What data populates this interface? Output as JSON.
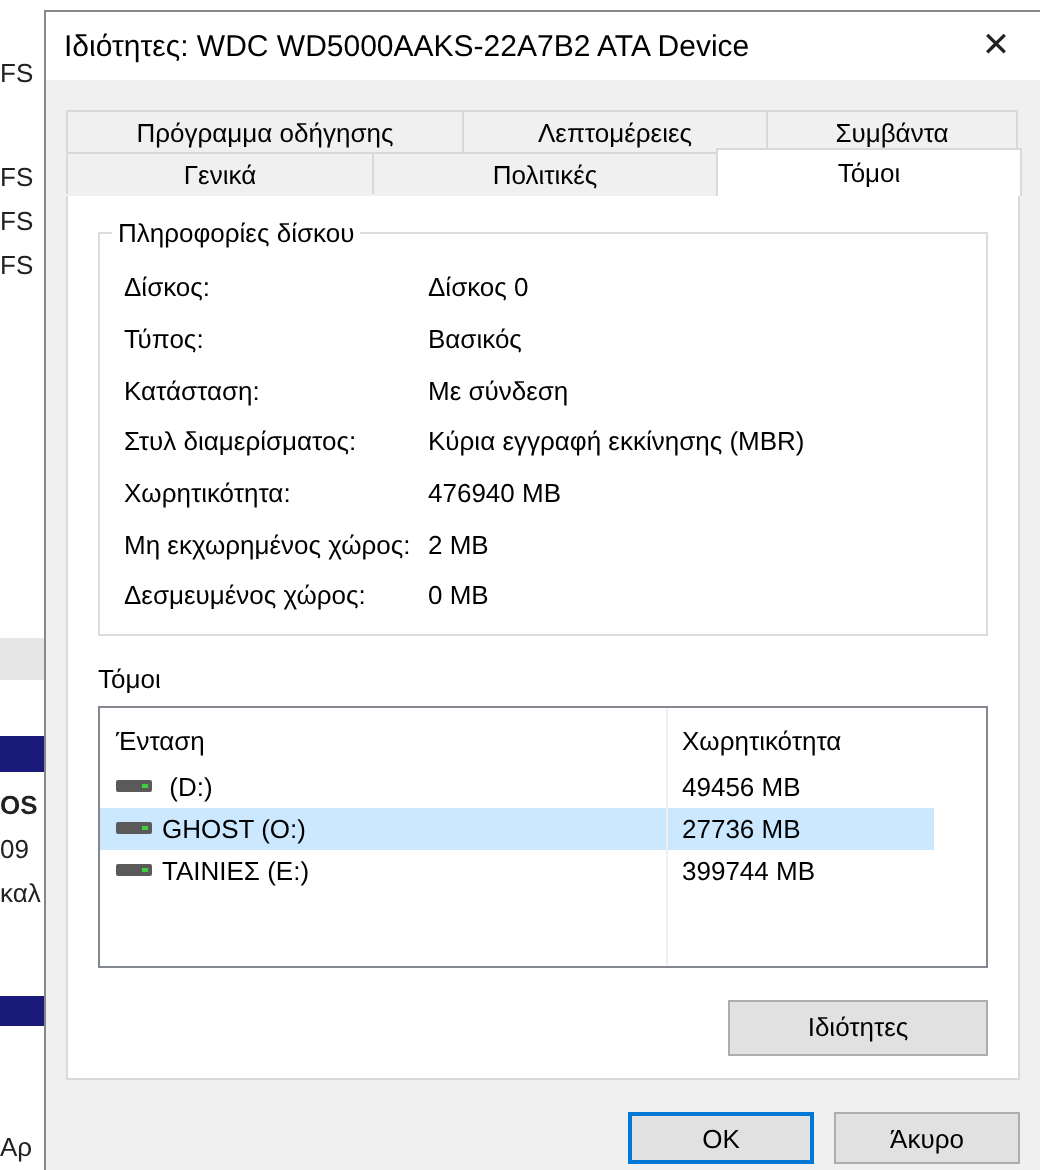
{
  "background_window": {
    "texts": [
      "FS",
      "FS",
      "FS",
      "FS"
    ],
    "lower_texts": [
      "OS",
      "09",
      "καλ"
    ],
    "bottom_text": "Αρ"
  },
  "window": {
    "title": "Ιδιότητες: WDC WD5000AAKS-22A7B2 ATA Device",
    "close": "✕"
  },
  "tab_rows": [
    [
      {
        "label": "Πρόγραμμα οδήγησης",
        "selected": false
      },
      {
        "label": "Λεπτομέρειες",
        "selected": false
      },
      {
        "label": "Συμβάντα",
        "selected": false
      }
    ],
    [
      {
        "label": "Γενικά",
        "selected": false
      },
      {
        "label": "Πολιτικές",
        "selected": false
      },
      {
        "label": "Τόμοι",
        "selected": true
      }
    ]
  ],
  "disk_info": {
    "title": "Πληροφορίες δίσκου",
    "rows": [
      {
        "label": "Δίσκος:",
        "value": "Δίσκος 0"
      },
      {
        "label": "Τύπος:",
        "value": "Βασικός"
      },
      {
        "label": "Κατάσταση:",
        "value": "Με σύνδεση"
      },
      {
        "label": "Στυλ διαμερίσματος:",
        "value": "Κύρια εγγραφή εκκίνησης (MBR)"
      },
      {
        "label": "Χωρητικότητα:",
        "value": "476940 MB"
      },
      {
        "label": "Μη εκχωρημένος χώρος:",
        "value": "2 MB"
      },
      {
        "label": "Δεσμευμένος χώρος:",
        "value": "0 MB"
      }
    ]
  },
  "volumes": {
    "title": "Τόμοι",
    "columns": [
      "Ένταση",
      "Χωρητικότητα"
    ],
    "rows": [
      {
        "volume": " (D:)",
        "capacity": "49456 MB",
        "selected": false
      },
      {
        "volume": "GHOST (O:)",
        "capacity": "27736 MB",
        "selected": true
      },
      {
        "volume": "ΤΑΙΝΙΕΣ (E:)",
        "capacity": "399744 MB",
        "selected": false
      }
    ],
    "button": "Ιδιότητες"
  },
  "buttons": [
    {
      "label": "OK",
      "focused": true
    },
    {
      "label": "Άκυρο",
      "focused": false
    }
  ]
}
